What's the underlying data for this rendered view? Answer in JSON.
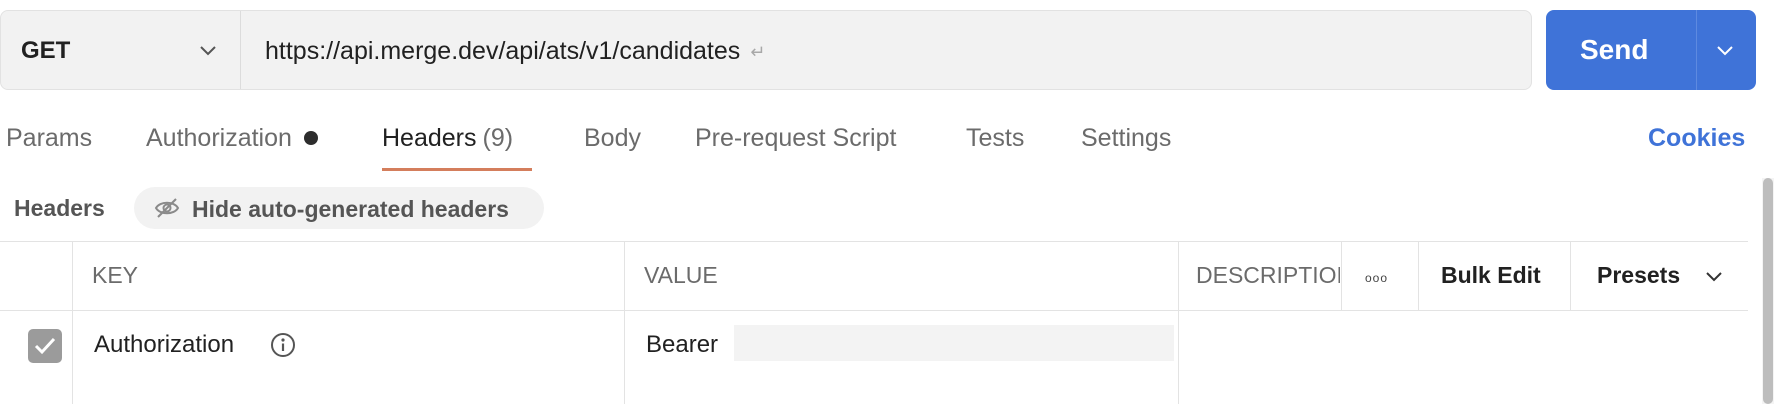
{
  "request": {
    "method": "GET",
    "url": "https://api.merge.dev/api/ats/v1/candidates",
    "return_glyph": "↵"
  },
  "send": {
    "label": "Send"
  },
  "tabs": [
    {
      "label": "Params"
    },
    {
      "label": "Authorization",
      "has_dot": true
    },
    {
      "label": "Headers",
      "count": "(9)",
      "active": true
    },
    {
      "label": "Body"
    },
    {
      "label": "Pre-request Script"
    },
    {
      "label": "Tests"
    },
    {
      "label": "Settings"
    }
  ],
  "cookies_label": "Cookies",
  "headers_toolbar": {
    "title": "Headers",
    "hide_auto_label": "Hide auto-generated headers"
  },
  "table": {
    "columns": {
      "key": "KEY",
      "value": "VALUE",
      "description": "DESCRIPTION"
    },
    "more_glyph": "ooo",
    "bulk_edit": "Bulk Edit",
    "presets": "Presets",
    "rows": [
      {
        "checked": true,
        "key": "Authorization",
        "value": "Bearer"
      }
    ]
  },
  "colors": {
    "accent_blue": "#3f73d8",
    "active_tab_underline": "#d47e5c",
    "checkbox_gray": "#9b9b9b"
  }
}
